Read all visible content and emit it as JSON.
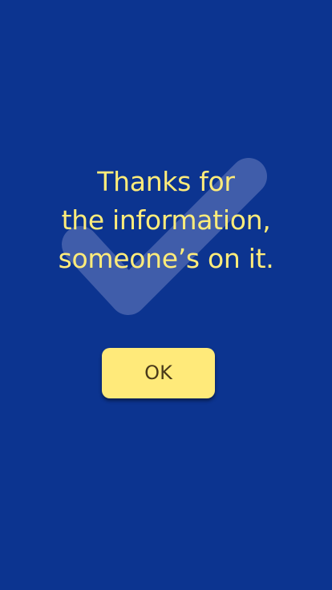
{
  "colors": {
    "background": "#0c3490",
    "message_text": "#ffec7a",
    "button_background": "#ffea7a",
    "button_text": "#4a3a1a",
    "watermark": "#6b7fbf"
  },
  "icons": {
    "watermark": "checkmark-icon"
  },
  "confirmation": {
    "message_lines": [
      "Thanks for",
      "the information,",
      "someone’s on it."
    ],
    "ok_label": "OK"
  }
}
